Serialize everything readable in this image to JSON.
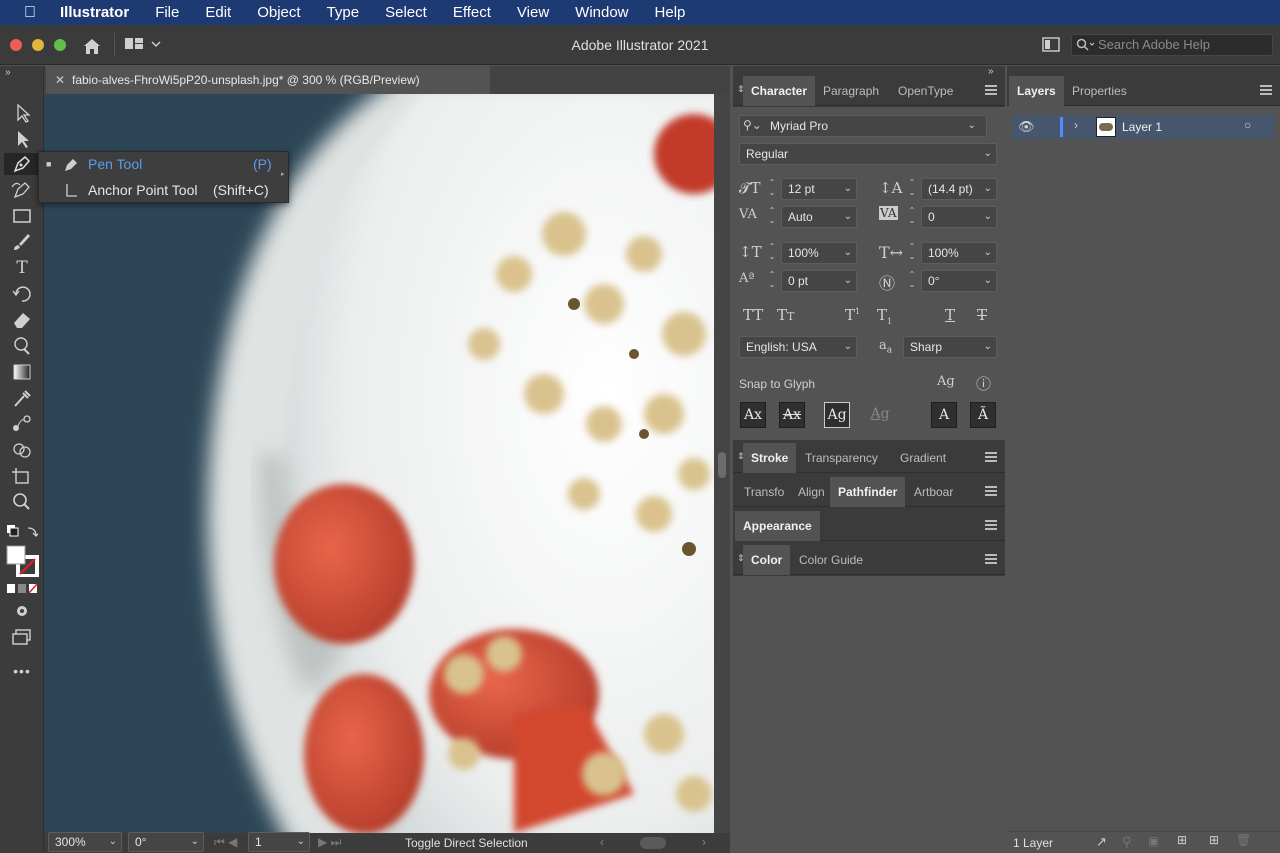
{
  "menubar": {
    "items": [
      "Illustrator",
      "File",
      "Edit",
      "Object",
      "Type",
      "Select",
      "Effect",
      "View",
      "Window",
      "Help"
    ]
  },
  "appbar": {
    "title": "Adobe Illustrator 2021",
    "search_placeholder": "Search Adobe Help"
  },
  "document": {
    "tab_title": "fabio-alves-FhroWi5pP20-unsplash.jpg* @ 300 % (RGB/Preview)"
  },
  "flyout": {
    "items": [
      {
        "label": "Pen Tool",
        "shortcut": "(P)",
        "selected": true
      },
      {
        "label": "Anchor Point Tool",
        "shortcut": "(Shift+C)",
        "selected": false
      }
    ]
  },
  "status": {
    "zoom": "300%",
    "rotation": "0°",
    "artboard": "1",
    "message": "Toggle Direct Selection"
  },
  "character_panel": {
    "tabs": [
      "Character",
      "Paragraph",
      "OpenType"
    ],
    "font_family": "Myriad Pro",
    "font_style": "Regular",
    "font_size": "12 pt",
    "leading": "(14.4 pt)",
    "kerning": "Auto",
    "tracking": "0",
    "vertical_scale": "100%",
    "horizontal_scale": "100%",
    "baseline_shift": "0 pt",
    "rotation": "0°",
    "language": "English: USA",
    "antialias": "Sharp",
    "snap_to_glyph": "Snap to Glyph"
  },
  "stroke_group": {
    "tabs": [
      "Stroke",
      "Transparency",
      "Gradient"
    ]
  },
  "transform_group": {
    "tabs": [
      "Transfo",
      "Align",
      "Pathfinder",
      "Artboar"
    ]
  },
  "appearance_group": {
    "tabs": [
      "Appearance"
    ]
  },
  "color_group": {
    "tabs": [
      "Color",
      "Color Guide"
    ]
  },
  "layers_panel": {
    "tabs": [
      "Layers",
      "Properties"
    ],
    "layers": [
      {
        "name": "Layer 1"
      }
    ],
    "footer": "1 Layer"
  },
  "colors": {
    "menubar_bg": "#1d3a73",
    "accent_blue": "#5b9bf2",
    "panel_bg": "#535353",
    "toolbar_bg": "#3c3c3c"
  }
}
